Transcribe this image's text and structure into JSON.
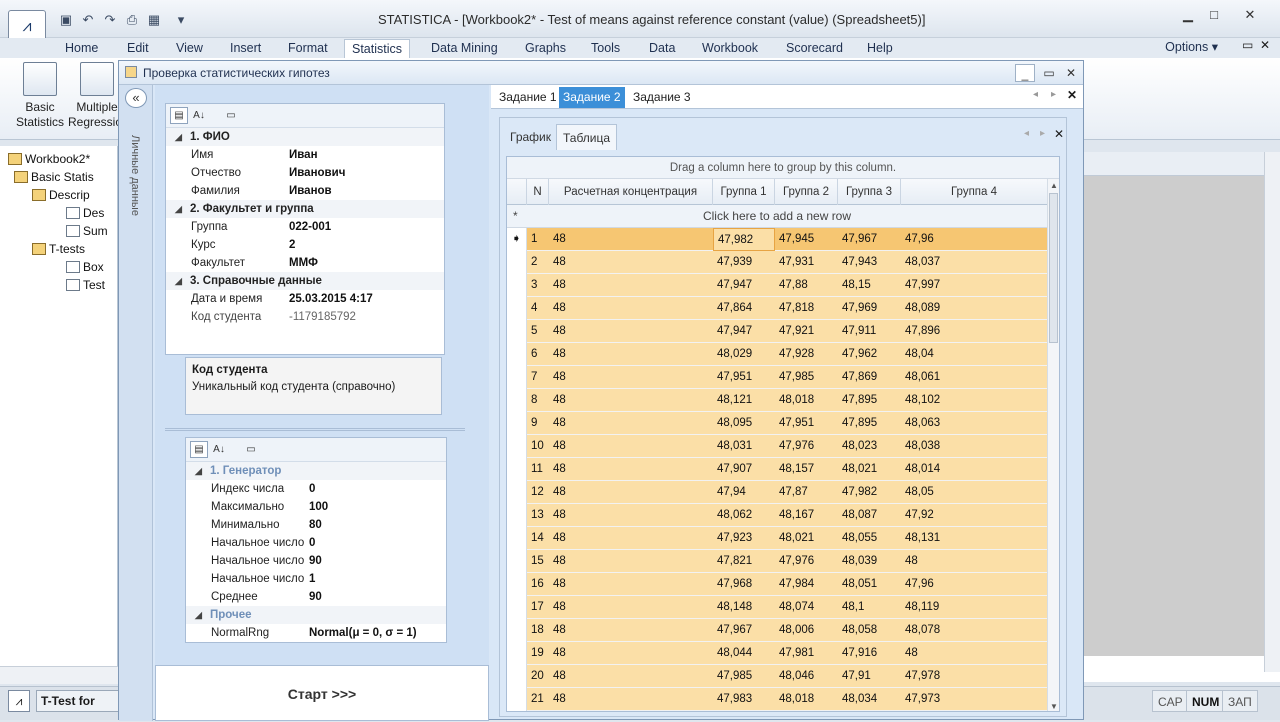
{
  "app": {
    "title": "STATISTICA - [Workbook2* - Test of means against reference constant (value) (Spreadsheet5)]",
    "quick_access": [
      "save-icon",
      "undo-icon",
      "redo-icon",
      "print-icon",
      "sheet-icon"
    ]
  },
  "ribbon": {
    "tabs": [
      "Home",
      "Edit",
      "View",
      "Insert",
      "Format",
      "Statistics",
      "Data Mining",
      "Graphs",
      "Tools",
      "Data",
      "Workbook",
      "Scorecard",
      "Help"
    ],
    "active_tab": "Statistics",
    "options_label": "Options ▾",
    "buttons": [
      {
        "label1": "Basic",
        "label2": "Statistics"
      },
      {
        "label1": "Multiple",
        "label2": "Regression"
      }
    ]
  },
  "tree": {
    "items": [
      {
        "label": "Workbook2*",
        "icon": "folder-icon"
      },
      {
        "label": "Basic Statis",
        "icon": "folder-icon"
      },
      {
        "label": "Descrip",
        "icon": "folder-icon"
      },
      {
        "label": "Des",
        "icon": "spreadsheet-icon"
      },
      {
        "label": "Sum",
        "icon": "spreadsheet-icon"
      },
      {
        "label": "T-tests",
        "icon": "folder-icon"
      },
      {
        "label": "Box",
        "icon": "graph-icon"
      },
      {
        "label": "Test",
        "icon": "spreadsheet-icon"
      }
    ]
  },
  "taskbar": {
    "item_label": "T-Test for",
    "cap": "CAP",
    "num": "NUM",
    "zap": "ЗАП"
  },
  "dialog": {
    "title": "Проверка статистических гипотез",
    "side_label": "Личные данные",
    "props": [
      {
        "type": "cat",
        "label": "1. ФИО"
      },
      {
        "label": "Имя",
        "value": "Иван"
      },
      {
        "label": "Отчество",
        "value": "Иванович"
      },
      {
        "label": "Фамилия",
        "value": "Иванов"
      },
      {
        "type": "cat",
        "label": "2. Факультет и группа"
      },
      {
        "label": "Группа",
        "value": "022-001"
      },
      {
        "label": "Курс",
        "value": "2"
      },
      {
        "label": "Факультет",
        "value": "ММФ"
      },
      {
        "type": "cat",
        "label": "3. Справочные данные"
      },
      {
        "label": "Дата и время",
        "value": "25.03.2015 4:17"
      },
      {
        "label": "Код студента",
        "value": "-1179185792",
        "muted": true
      }
    ],
    "desc": {
      "title": "Код студента",
      "text": "Уникальный код студента (справочно)"
    },
    "generator": [
      {
        "type": "cat",
        "label": "1. Генератор"
      },
      {
        "label": "Индекс числа",
        "value": "0"
      },
      {
        "label": "Максимально",
        "value": "100"
      },
      {
        "label": "Минимально",
        "value": "80"
      },
      {
        "label": "Начальное число",
        "value": "0"
      },
      {
        "label": "Начальное число",
        "value": "90"
      },
      {
        "label": "Начальное число",
        "value": "1"
      },
      {
        "label": "Среднее",
        "value": "90"
      },
      {
        "type": "cat",
        "label": "Прочее"
      },
      {
        "label": "NormalRng",
        "value": "Normal(μ = 0, σ = 1)"
      }
    ],
    "start_label": "Старт >>>",
    "task_tabs": [
      "Задание 1",
      "Задание 2",
      "Задание 3"
    ],
    "active_task": "Задание 2",
    "inner_tabs": [
      "График",
      "Таблица"
    ],
    "active_inner": "Таблица",
    "table": {
      "group_hint": "Drag a column here to group by this column.",
      "new_row": "Click here to add a new row",
      "columns": [
        "N",
        "Расчетная концентрация",
        "Группа 1",
        "Группа 2",
        "Группа 3",
        "Группа 4"
      ],
      "rows": [
        [
          "1",
          "48",
          "47,982",
          "47,945",
          "47,967",
          "47,96"
        ],
        [
          "2",
          "48",
          "47,939",
          "47,931",
          "47,943",
          "48,037"
        ],
        [
          "3",
          "48",
          "47,947",
          "47,88",
          "48,15",
          "47,997"
        ],
        [
          "4",
          "48",
          "47,864",
          "47,818",
          "47,969",
          "48,089"
        ],
        [
          "5",
          "48",
          "47,947",
          "47,921",
          "47,911",
          "47,896"
        ],
        [
          "6",
          "48",
          "48,029",
          "47,928",
          "47,962",
          "48,04"
        ],
        [
          "7",
          "48",
          "47,951",
          "47,985",
          "47,869",
          "48,061"
        ],
        [
          "8",
          "48",
          "48,121",
          "48,018",
          "47,895",
          "48,102"
        ],
        [
          "9",
          "48",
          "48,095",
          "47,951",
          "47,895",
          "48,063"
        ],
        [
          "10",
          "48",
          "48,031",
          "47,976",
          "48,023",
          "48,038"
        ],
        [
          "11",
          "48",
          "47,907",
          "48,157",
          "48,021",
          "48,014"
        ],
        [
          "12",
          "48",
          "47,94",
          "47,87",
          "47,982",
          "48,05"
        ],
        [
          "13",
          "48",
          "48,062",
          "48,167",
          "48,087",
          "47,92"
        ],
        [
          "14",
          "48",
          "47,923",
          "48,021",
          "48,055",
          "48,131"
        ],
        [
          "15",
          "48",
          "47,821",
          "47,976",
          "48,039",
          "48"
        ],
        [
          "16",
          "48",
          "47,968",
          "47,984",
          "48,051",
          "47,96"
        ],
        [
          "17",
          "48",
          "48,148",
          "48,074",
          "48,1",
          "48,119"
        ],
        [
          "18",
          "48",
          "47,967",
          "48,006",
          "48,058",
          "48,078"
        ],
        [
          "19",
          "48",
          "48,044",
          "47,981",
          "47,916",
          "48"
        ],
        [
          "20",
          "48",
          "47,985",
          "48,046",
          "47,91",
          "47,978"
        ],
        [
          "21",
          "48",
          "47,983",
          "48,018",
          "48,034",
          "47,973"
        ]
      ]
    }
  }
}
